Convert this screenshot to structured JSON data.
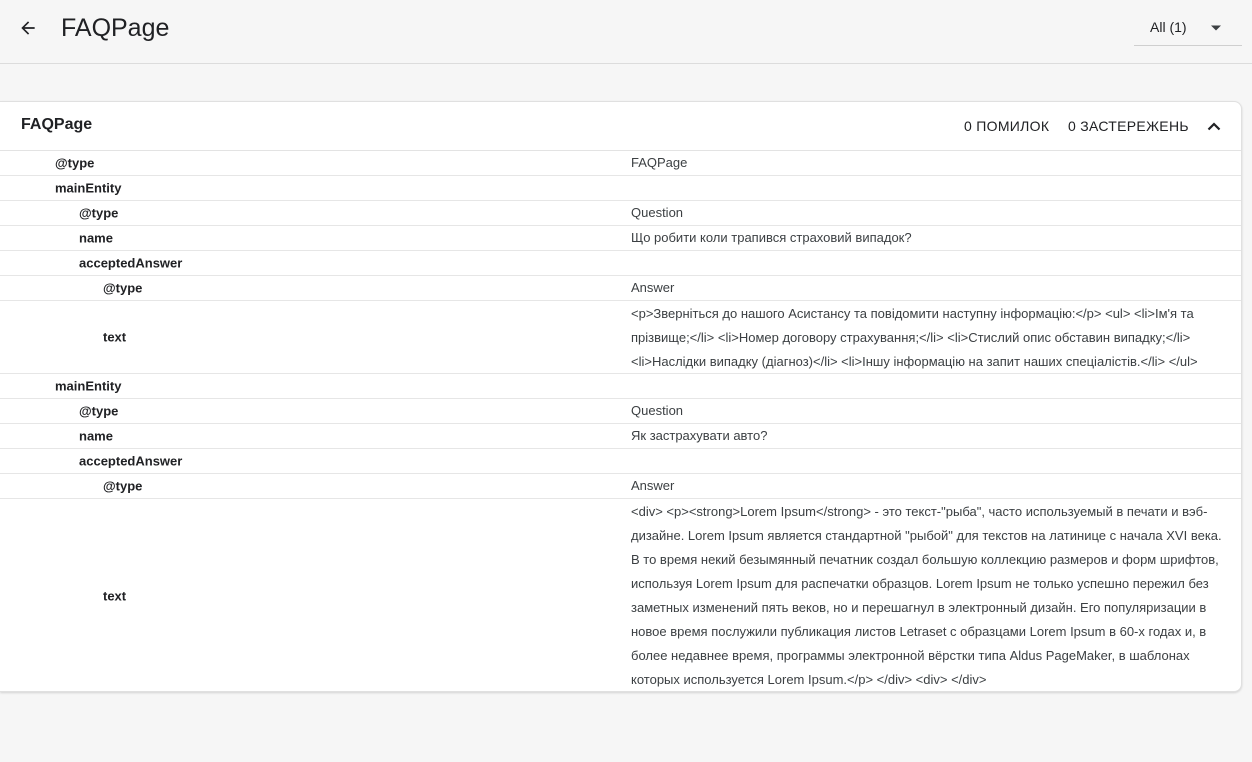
{
  "header": {
    "title": "FAQPage",
    "filter_label": "All (1)"
  },
  "card": {
    "title": "FAQPage",
    "errors": "0 ПОМИЛОК",
    "warnings": "0 ЗАСТЕРЕЖЕНЬ"
  },
  "rows": {
    "r1": {
      "key": "@type",
      "value": "FAQPage"
    },
    "r2": {
      "key": "mainEntity",
      "value": ""
    },
    "r3": {
      "key": "@type",
      "value": "Question"
    },
    "r4": {
      "key": "name",
      "value": "Що робити коли трапився страховий випадок?"
    },
    "r5": {
      "key": "acceptedAnswer",
      "value": ""
    },
    "r6": {
      "key": "@type",
      "value": "Answer"
    },
    "r7": {
      "key": "text",
      "value": "<p>Зверніться до нашого Асистансу та повідомити наступну інформацію:</p> <ul> <li>Ім'я та прізвище;</li> <li>Номер договору страхування;</li> <li>Стислий опис обставин випадку;</li> <li>Наслідки випадку (діагноз)</li> <li>Іншу інформацію на запит наших спеціалістів.</li> </ul>"
    },
    "r8": {
      "key": "mainEntity",
      "value": ""
    },
    "r9": {
      "key": "@type",
      "value": "Question"
    },
    "r10": {
      "key": "name",
      "value": "Як застрахувати авто?"
    },
    "r11": {
      "key": "acceptedAnswer",
      "value": ""
    },
    "r12": {
      "key": "@type",
      "value": "Answer"
    },
    "r13": {
      "key": "text",
      "value": "<div> <p><strong>Lorem Ipsum</strong> - это текст-\"рыба\", часто используемый в печати и вэб-дизайне. Lorem Ipsum является стандартной \"рыбой\" для текстов на латинице с начала XVI века. В то время некий безымянный печатник создал большую коллекцию размеров и форм шрифтов, используя Lorem Ipsum для распечатки образцов. Lorem Ipsum не только успешно пережил без заметных изменений пять веков, но и перешагнул в электронный дизайн. Его популяризации в новое время послужили публикация листов Letraset с образцами Lorem Ipsum в 60-х годах и, в более недавнее время, программы электронной вёрстки типа Aldus PageMaker, в шаблонах которых используется Lorem Ipsum.</p> </div> <div> </div>"
    }
  },
  "icons": {
    "back": "arrow-left-icon",
    "filter": "caret-down-icon",
    "collapse": "chevron-up-icon"
  }
}
